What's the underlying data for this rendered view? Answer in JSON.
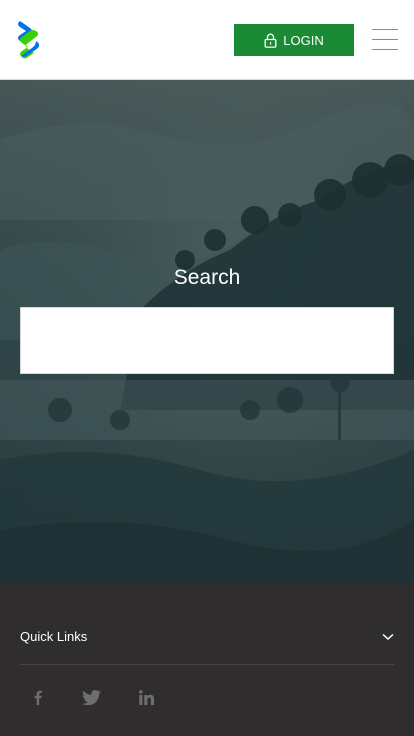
{
  "header": {
    "login_label": "LOGIN",
    "logo": "standard-chartered-logo",
    "menu_icon": "hamburger-menu-icon",
    "login_icon": "lock-icon",
    "colors": {
      "login_bg": "#1a8b34",
      "logo_blue": "#0473ea",
      "logo_green": "#38d200"
    }
  },
  "hero": {
    "title": "Search",
    "search_value": "",
    "search_placeholder": ""
  },
  "footer": {
    "quick_links_label": "Quick Links",
    "quick_links_icon": "chevron-down-icon",
    "social": [
      "facebook-icon",
      "twitter-icon",
      "linkedin-icon"
    ],
    "colors": {
      "background": "#2f2d2d",
      "icon": "#6f6d6d"
    }
  }
}
